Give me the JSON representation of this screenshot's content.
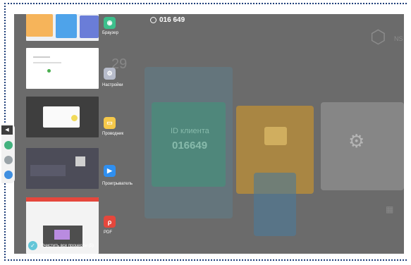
{
  "connection": {
    "id": "016 649"
  },
  "background": {
    "number": "29",
    "watermark_small": "ID клиента",
    "watermark_big": "016649",
    "corner_text": "NS"
  },
  "apps": [
    {
      "label": "Браузер",
      "icon": "browser-icon",
      "color": "#3dbf8c"
    },
    {
      "label": "Настройки",
      "icon": "settings-icon",
      "color": "#b7bccb"
    },
    {
      "label": "Проводник",
      "icon": "folder-icon",
      "color": "#f5c84a"
    },
    {
      "label": "Проигрыватель",
      "icon": "play-icon",
      "color": "#2f8ff0"
    },
    {
      "label": "PDF",
      "icon": "pdf-icon",
      "color": "#e5473c"
    }
  ],
  "clear": {
    "label": "Очистить все процессы (5)"
  },
  "colors": {
    "dock_green": "#43b27e",
    "dock_gray": "#9aa3a8",
    "dock_blue": "#3f8fe0"
  }
}
